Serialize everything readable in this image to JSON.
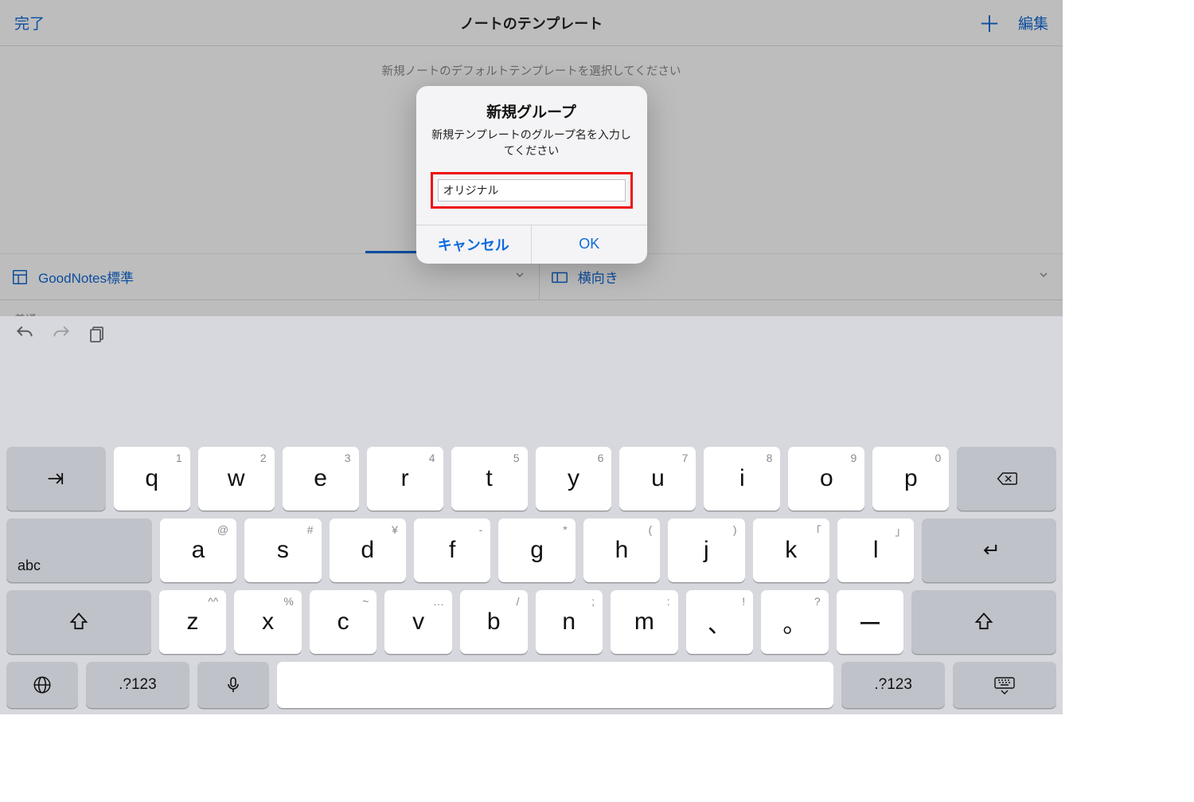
{
  "header": {
    "done": "完了",
    "title": "ノートのテンプレート",
    "edit": "編集"
  },
  "subhead": "新規ノートのデフォルトテンプレートを選択してください",
  "settings": {
    "templateGroup": "GoodNotes標準",
    "orientation": "横向き"
  },
  "sectionLabel": "普通",
  "modal": {
    "title": "新規グループ",
    "message": "新規テンプレートのグループ名を入力してください",
    "inputValue": "オリジナル",
    "cancel": "キャンセル",
    "ok": "OK"
  },
  "keyboard": {
    "abcLabel": "abc",
    "numLabel": ".?123",
    "rows": [
      [
        {
          "m": "q",
          "a": "1"
        },
        {
          "m": "w",
          "a": "2"
        },
        {
          "m": "e",
          "a": "3"
        },
        {
          "m": "r",
          "a": "4"
        },
        {
          "m": "t",
          "a": "5"
        },
        {
          "m": "y",
          "a": "6"
        },
        {
          "m": "u",
          "a": "7"
        },
        {
          "m": "i",
          "a": "8"
        },
        {
          "m": "o",
          "a": "9"
        },
        {
          "m": "p",
          "a": "0"
        }
      ],
      [
        {
          "m": "a",
          "a": "@"
        },
        {
          "m": "s",
          "a": "#"
        },
        {
          "m": "d",
          "a": "¥"
        },
        {
          "m": "f",
          "a": "-"
        },
        {
          "m": "g",
          "a": "*"
        },
        {
          "m": "h",
          "a": "("
        },
        {
          "m": "j",
          "a": ")"
        },
        {
          "m": "k",
          "a": "「"
        },
        {
          "m": "l",
          "a": "」"
        }
      ],
      [
        {
          "m": "z",
          "a": "^^"
        },
        {
          "m": "x",
          "a": "%"
        },
        {
          "m": "c",
          "a": "~"
        },
        {
          "m": "v",
          "a": "…"
        },
        {
          "m": "b",
          "a": "/"
        },
        {
          "m": "n",
          "a": ";"
        },
        {
          "m": "m",
          "a": ":"
        },
        {
          "m": "、",
          "a": "!"
        },
        {
          "m": "。",
          "a": "?"
        },
        {
          "m": "ー",
          "a": ""
        }
      ]
    ]
  }
}
